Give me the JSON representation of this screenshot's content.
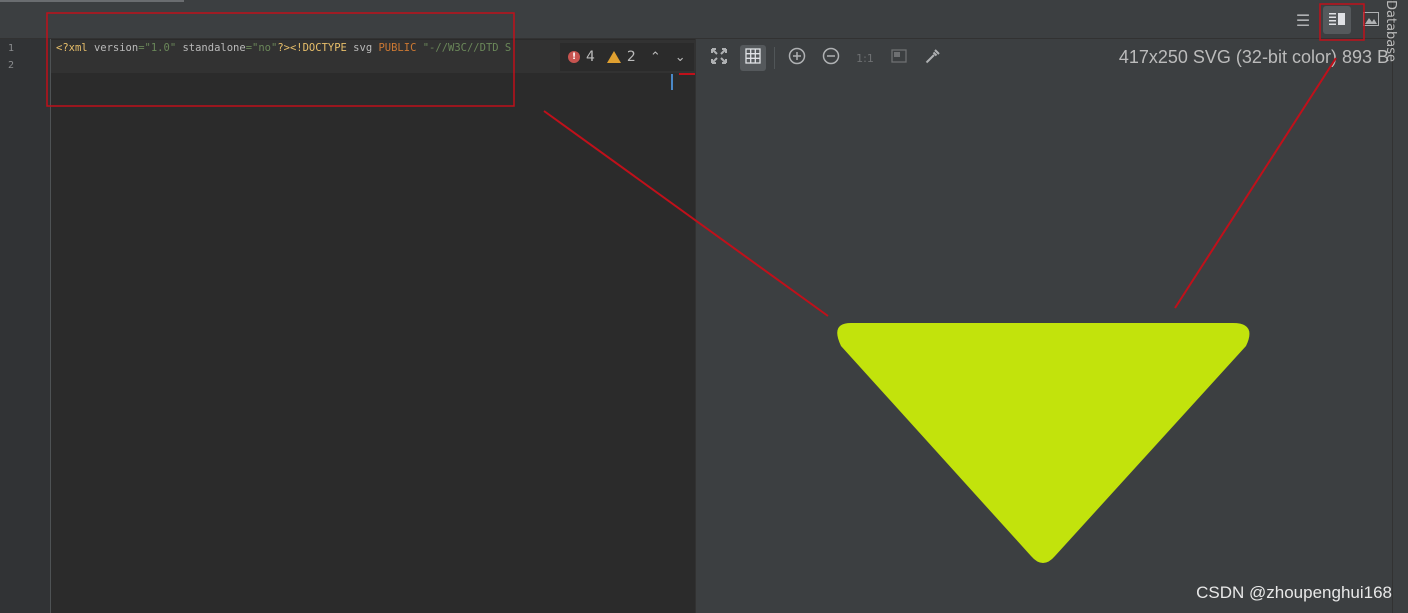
{
  "editor": {
    "line_numbers": [
      "1",
      "2"
    ],
    "code_tokens": {
      "t1": "<?xml ",
      "t2": "version",
      "t3": "=",
      "t4": "\"1.0\"",
      "t5": " standalone",
      "t6": "=",
      "t7": "\"no\"",
      "t8": "?><!DOCTYPE ",
      "t9": "svg ",
      "t10": "PUBLIC ",
      "t11": "\"-//W3C//DTD S"
    },
    "inspections": {
      "errors": "4",
      "warnings": "2"
    }
  },
  "view_modes": {
    "editor_only_icon": "editor-only-icon",
    "split_icon": "split-view-icon",
    "preview_only_icon": "preview-only-icon",
    "active": "split"
  },
  "preview": {
    "image_info": "417x250 SVG (32-bit color) 893 B",
    "zoom_actual": "1:1",
    "toolbar_icons": [
      "fit-zoom-icon",
      "grid-icon",
      "zoom-in-icon",
      "zoom-out-icon",
      "actual-size-icon",
      "background-icon",
      "color-picker-icon"
    ],
    "triangle_color": "#c2e30c"
  },
  "side_panel": {
    "label": "Database"
  },
  "annotation_color": "#c0101a",
  "watermark": "CSDN @zhoupenghui168"
}
